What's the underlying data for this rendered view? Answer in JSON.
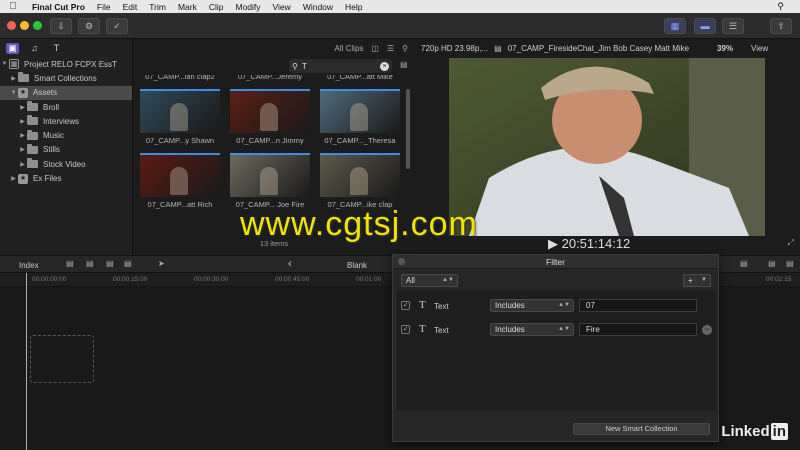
{
  "menubar": {
    "apple": "",
    "items": [
      "Final Cut Pro",
      "File",
      "Edit",
      "Trim",
      "Mark",
      "Clip",
      "Modify",
      "View",
      "Window",
      "Help"
    ]
  },
  "sidebar": {
    "library": "Project RELO FCPX EssT",
    "items": [
      {
        "label": "Smart Collections",
        "indent": 1,
        "kind": "folder"
      },
      {
        "label": "Assets",
        "indent": 1,
        "kind": "event",
        "selected": true
      },
      {
        "label": "Broll",
        "indent": 2,
        "kind": "folder"
      },
      {
        "label": "Interviews",
        "indent": 2,
        "kind": "folder"
      },
      {
        "label": "Music",
        "indent": 2,
        "kind": "folder"
      },
      {
        "label": "Stills",
        "indent": 2,
        "kind": "folder"
      },
      {
        "label": "Stock Video",
        "indent": 2,
        "kind": "folder"
      },
      {
        "label": "Ex Files",
        "indent": 1,
        "kind": "event"
      }
    ]
  },
  "browser": {
    "all_clips": "All Clips",
    "filter_token": "T",
    "clips": [
      {
        "label": "07_CAMP...ian clap2",
        "tone": "#3d3a35"
      },
      {
        "label": "07_CAMP...Jeremy",
        "tone": "#3a3530"
      },
      {
        "label": "07_CAMP...att Mike",
        "tone": "#4a463f"
      },
      {
        "label": "07_CAMP...y Shawn",
        "tone": "#2f4a58"
      },
      {
        "label": "07_CAMP...n Jimmy",
        "tone": "#5a1e14"
      },
      {
        "label": "07_CAMP..._Theresa",
        "tone": "#4f6b7a"
      },
      {
        "label": "07_CAMP...att Rich",
        "tone": "#5a1a12"
      },
      {
        "label": "07_CAMP... Joe Fire",
        "tone": "#6c6a5c"
      },
      {
        "label": "07_CAMP...ike clap",
        "tone": "#5c5a4a"
      }
    ],
    "count": "13 items"
  },
  "viewer": {
    "format": "720p HD 23.98p,...",
    "clip_name": "07_CAMP_FiresideChat_Jim Bob Casey Matt Mike",
    "zoom": "39%",
    "view": "View",
    "timecode": "20:51:14:12"
  },
  "timeline": {
    "index": "Index",
    "blank": "Blank",
    "ruler_labels": [
      "00:00:00:00",
      "00:00:15:00",
      "00:00:30:00",
      "00:00:45:00",
      "00:01:00",
      "00:02:15"
    ]
  },
  "filter": {
    "title": "Filter",
    "match": "All",
    "rows": [
      {
        "type": "Text",
        "op": "Includes",
        "value": "07"
      },
      {
        "type": "Text",
        "op": "Includes",
        "value": "Fire"
      }
    ],
    "new_collection": "New Smart Collection"
  },
  "watermark": "www.cgtsj.com",
  "brand": "Linked"
}
